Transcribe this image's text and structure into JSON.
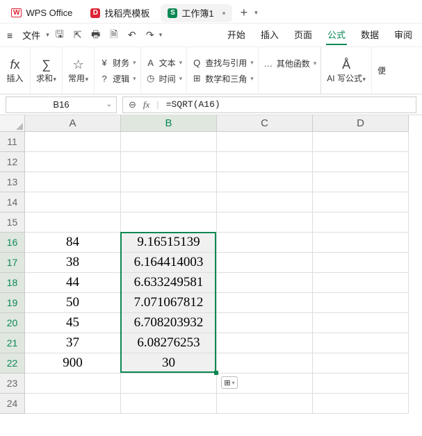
{
  "titlebar": {
    "app_label": "WPS Office",
    "docell_label": "找稻壳模板",
    "sheet_label": "工作簿1",
    "plus": "+"
  },
  "menu": {
    "file": "文件",
    "tabs": [
      "开始",
      "插入",
      "页面",
      "公式",
      "数据",
      "审阅"
    ],
    "active_index": 3
  },
  "ribbon": {
    "insert": "插入",
    "sum": "求和",
    "common": "常用",
    "finance": "财务",
    "logic": "逻辑",
    "text": "文本",
    "time": "时间",
    "lookup": "查找与引用",
    "math": "数学和三角",
    "other": "其他函数",
    "ai": "AI 写公式",
    "fast": "便"
  },
  "namebox": "B16",
  "formula": "=SQRT(A16)",
  "columns": [
    "A",
    "B",
    "C",
    "D"
  ],
  "sel_col_index": 1,
  "rows": [
    {
      "n": 11,
      "a": "",
      "b": ""
    },
    {
      "n": 12,
      "a": "",
      "b": ""
    },
    {
      "n": 13,
      "a": "",
      "b": ""
    },
    {
      "n": 14,
      "a": "",
      "b": ""
    },
    {
      "n": 15,
      "a": "",
      "b": ""
    },
    {
      "n": 16,
      "a": "84",
      "b": "9.16515139"
    },
    {
      "n": 17,
      "a": "38",
      "b": "6.164414003"
    },
    {
      "n": 18,
      "a": "44",
      "b": "6.633249581"
    },
    {
      "n": 19,
      "a": "50",
      "b": "7.071067812"
    },
    {
      "n": 20,
      "a": "45",
      "b": "6.708203932"
    },
    {
      "n": 21,
      "a": "37",
      "b": "6.08276253"
    },
    {
      "n": 22,
      "a": "900",
      "b": "30"
    },
    {
      "n": 23,
      "a": "",
      "b": ""
    },
    {
      "n": 24,
      "a": "",
      "b": ""
    }
  ],
  "sel_rows": [
    16,
    17,
    18,
    19,
    20,
    21,
    22
  ],
  "colors": {
    "accent": "#0a8852",
    "arrow": "#ff0000"
  }
}
